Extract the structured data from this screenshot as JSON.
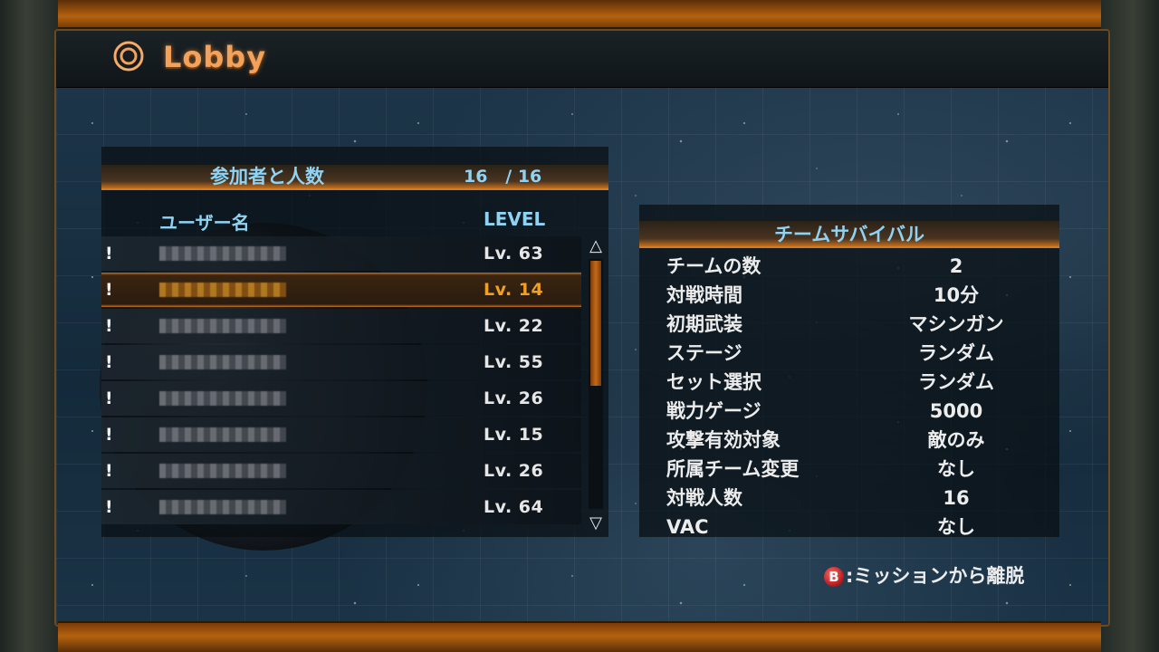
{
  "screen": {
    "title": "Lobby"
  },
  "participants": {
    "header_label": "参加者と人数",
    "count": "16   / 16",
    "column_user": "ユーザー名",
    "column_level": "LEVEL",
    "players": [
      {
        "marker": "!",
        "level": "Lv. 63",
        "selected": false
      },
      {
        "marker": "!",
        "level": "Lv. 14",
        "selected": true
      },
      {
        "marker": "!",
        "level": "Lv. 22",
        "selected": false
      },
      {
        "marker": "!",
        "level": "Lv. 55",
        "selected": false
      },
      {
        "marker": "!",
        "level": "Lv. 26",
        "selected": false
      },
      {
        "marker": "!",
        "level": "Lv. 15",
        "selected": false
      },
      {
        "marker": "!",
        "level": "Lv. 26",
        "selected": false
      },
      {
        "marker": "!",
        "level": "Lv. 64",
        "selected": false
      }
    ],
    "scroll_up_icon": "△",
    "scroll_down_icon": "▽"
  },
  "mode": {
    "title": "チームサバイバル",
    "settings": [
      {
        "key": "チームの数",
        "value": "2"
      },
      {
        "key": "対戦時間",
        "value": "10分"
      },
      {
        "key": "初期武装",
        "value": "マシンガン"
      },
      {
        "key": "ステージ",
        "value": "ランダム"
      },
      {
        "key": "セット選択",
        "value": "ランダム"
      },
      {
        "key": "戦力ゲージ",
        "value": "5000"
      },
      {
        "key": "攻撃有効対象",
        "value": "敵のみ"
      },
      {
        "key": "所属チーム変更",
        "value": "なし"
      },
      {
        "key": "対戦人数",
        "value": "16"
      },
      {
        "key": "VAC",
        "value": "なし"
      }
    ]
  },
  "hint": {
    "button": "B",
    "text": ":ミッションから離脱"
  },
  "colors": {
    "accent_orange": "#d37a22",
    "header_text": "#8fd3f4",
    "selected_level": "#f2a020"
  }
}
